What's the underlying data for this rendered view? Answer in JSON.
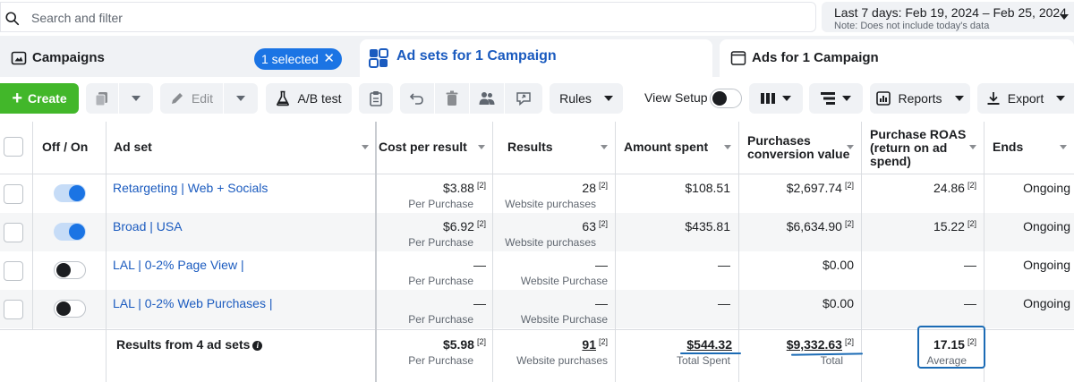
{
  "search": {
    "placeholder": "Search and filter"
  },
  "date_range": {
    "label": "Last 7 days: Feb 19, 2024 – Feb 25, 2024",
    "note": "Note: Does not include today's data"
  },
  "tabs": {
    "campaigns": {
      "label": "Campaigns",
      "selected_label": "1 selected"
    },
    "adsets": {
      "label": "Ad sets for 1 Campaign"
    },
    "ads": {
      "label": "Ads for 1 Campaign"
    }
  },
  "toolbar": {
    "create_label": "Create",
    "edit_label": "Edit",
    "ab_test_label": "A/B test",
    "rules_label": "Rules",
    "view_setup_label": "View Setup",
    "reports_label": "Reports",
    "export_label": "Export"
  },
  "columns": {
    "off_on": "Off / On",
    "ad_set": "Ad set",
    "cost_per_result": "Cost per result",
    "results": "Results",
    "amount_spent": "Amount spent",
    "purchases_cv_1": "Purchases",
    "purchases_cv_2": "conversion value",
    "roas_1": "Purchase ROAS",
    "roas_2": "(return on ad",
    "roas_3": "spend)",
    "ends": "Ends"
  },
  "footnote_marker": "[2]",
  "rows": [
    {
      "on": true,
      "name": "Retargeting | Web + Socials",
      "cost": "$3.88",
      "cost_sub": "Per Purchase",
      "results": "28",
      "results_sub": "Website purchases",
      "spent": "$108.51",
      "conv_value": "$2,697.74",
      "roas": "24.86",
      "ends": "Ongoing"
    },
    {
      "on": true,
      "name": "Broad | USA",
      "cost": "$6.92",
      "cost_sub": "Per Purchase",
      "results": "63",
      "results_sub": "Website purchases",
      "spent": "$435.81",
      "conv_value": "$6,634.90",
      "roas": "15.22",
      "ends": "Ongoing"
    },
    {
      "on": false,
      "name": "LAL | 0-2% Page View |",
      "cost": "—",
      "cost_sub": "Per Purchase",
      "results": "—",
      "results_sub": "Website Purchase",
      "spent": "—",
      "conv_value": "$0.00",
      "roas": "—",
      "ends": "Ongoing"
    },
    {
      "on": false,
      "name": "LAL | 0-2% Web Purchases |",
      "cost": "—",
      "cost_sub": "Per Purchase",
      "results": "—",
      "results_sub": "Website Purchase",
      "spent": "—",
      "conv_value": "$0.00",
      "roas": "—",
      "ends": "Ongoing"
    }
  ],
  "summary": {
    "label": "Results from 4 ad sets",
    "info_icon": "i",
    "cost": "$5.98",
    "cost_sub": "Per Purchase",
    "results": "91",
    "results_sub": "Website purchases",
    "spent": "$544.32",
    "spent_sub": "Total Spent",
    "conv_value": "$9,332.63",
    "conv_value_sub": "Total",
    "roas": "17.15",
    "roas_sub": "Average"
  },
  "colors": {
    "create_green": "#42b72a",
    "link_blue": "#1b5bbf",
    "pill_blue": "#1b74e4",
    "annotation_blue": "#1b6bb5"
  }
}
